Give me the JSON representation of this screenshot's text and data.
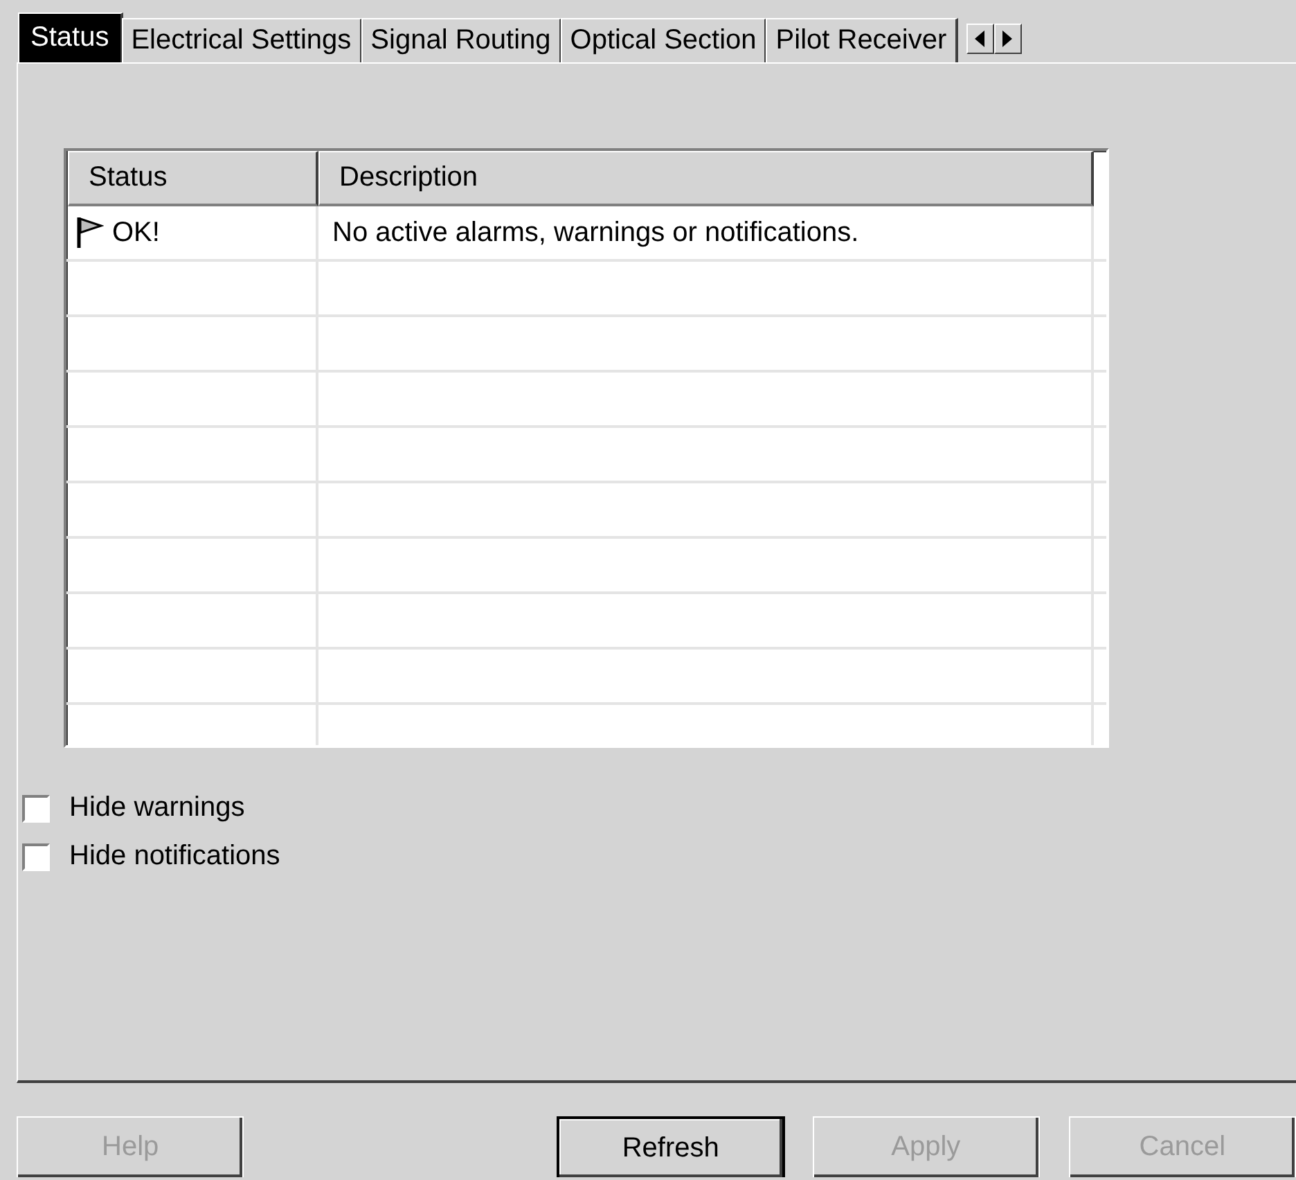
{
  "tabs": [
    {
      "label": "Status",
      "selected": true
    },
    {
      "label": "Electrical Settings",
      "selected": false
    },
    {
      "label": "Signal Routing",
      "selected": false
    },
    {
      "label": "Optical Section",
      "selected": false
    },
    {
      "label": "Pilot Receiver",
      "selected": false
    }
  ],
  "table": {
    "columns": [
      "Status",
      "Description"
    ],
    "rows": [
      {
        "status": "OK!",
        "description": "No active alarms, warnings or notifications."
      }
    ]
  },
  "checkboxes": [
    {
      "label": "Hide warnings",
      "checked": false
    },
    {
      "label": "Hide notifications",
      "checked": false
    }
  ],
  "buttons": [
    {
      "label": "Help",
      "disabled": true,
      "default": false
    },
    {
      "label": "Refresh",
      "disabled": false,
      "default": true
    },
    {
      "label": "Apply",
      "disabled": true,
      "default": false
    },
    {
      "label": "Cancel",
      "disabled": true,
      "default": false
    }
  ]
}
